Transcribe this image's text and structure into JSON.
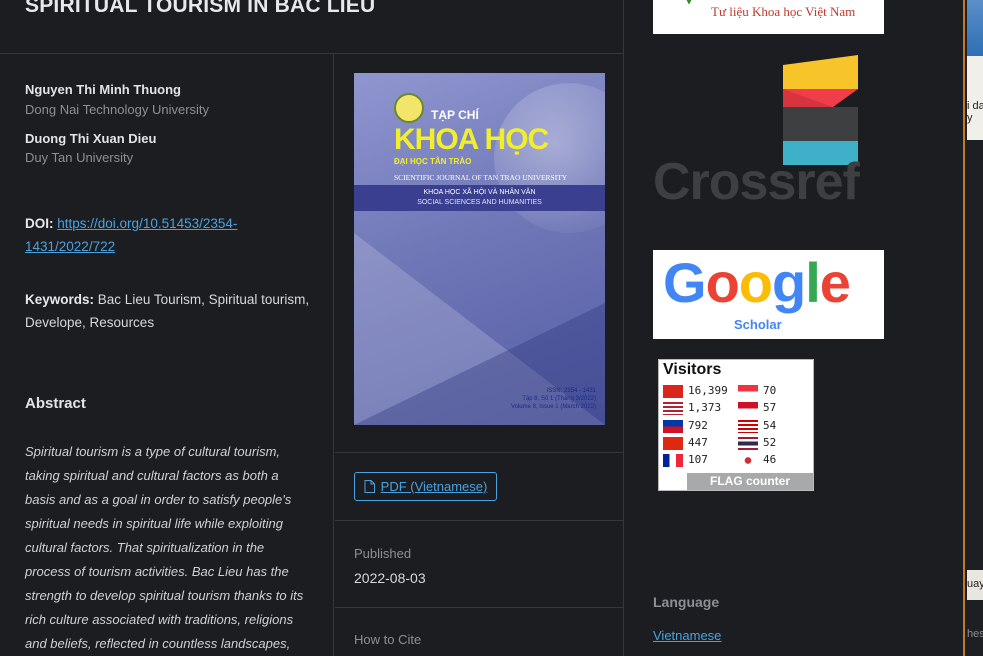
{
  "article": {
    "title": "SPIRITUAL TOURISM IN BAC LIEU",
    "authors": [
      {
        "name": "Nguyen Thi Minh Thuong",
        "affiliation": "Dong Nai Technology University"
      },
      {
        "name": "Duong Thi Xuan Dieu",
        "affiliation": "Duy Tan University"
      }
    ],
    "doi_label": "DOI:",
    "doi_url": "https://doi.org/10.51453/2354-1431/2022/722",
    "keywords_label": "Keywords:",
    "keywords": "Bac Lieu Tourism, Spiritual tourism, Develope, Resources",
    "abstract_heading": "Abstract",
    "abstract": "Spiritual tourism is a type of cultural tourism, taking spiritual and cultural factors as both a basis and as a goal in order to satisfy people's spiritual needs in spiritual life while exploiting cultural factors. That spiritualization in the process of tourism activities. Bac Lieu has the strength to develop spiritual tourism thanks to its rich culture associated with traditions, religions and beliefs, reflected in countless landscapes, monuments and"
  },
  "cover": {
    "line1": "TẠP CHÍ",
    "line2": "KHOA HỌC",
    "line3": "ĐẠI HỌC TÂN TRÀO",
    "line4": "SCIENTIFIC JOURNAL OF TAN TRAO UNIVERSITY",
    "line5": "KHOA HỌC XÃ HỘI VÀ NHÂN VĂN",
    "line6": "SOCIAL SCIENCES AND HUMANITIES",
    "issn": "ISSN: 2354 - 1431",
    "vol_vi": "Tập 8, Số 1 (Tháng 3/2022)",
    "vol_en": "Volume 8, Issue 1 (March 2022)"
  },
  "galley": {
    "pdf_label": "PDF (Vietnamese)"
  },
  "published": {
    "label": "Published",
    "date": "2022-08-03"
  },
  "cite": {
    "label": "How to Cite"
  },
  "sidebar": {
    "citation_text": "Tư liệu Khoa học Việt Nam",
    "crossref_text": "Crossref",
    "scholar_text": "Google",
    "scholar_sub": "Scholar",
    "visitors_title": "Visitors",
    "visitors_left": [
      {
        "flag": "vietnam-flag-icon",
        "count": "16,399"
      },
      {
        "flag": "usa-flag-icon",
        "count": "1,373"
      },
      {
        "flag": "philippines-flag-icon",
        "count": "792"
      },
      {
        "flag": "china-flag-icon",
        "count": "447"
      },
      {
        "flag": "france-flag-icon",
        "count": "107"
      }
    ],
    "visitors_right": [
      {
        "flag": "singapore-flag-icon",
        "count": "70"
      },
      {
        "flag": "indonesia-flag-icon",
        "count": "57"
      },
      {
        "flag": "malaysia-flag-icon",
        "count": "54"
      },
      {
        "flag": "thailand-flag-icon",
        "count": "52"
      },
      {
        "flag": "south-korea-flag-icon",
        "count": "46"
      }
    ],
    "flag_counter_text": "FLAG counter",
    "language_heading": "Language",
    "language_value": "Vietnamese"
  },
  "edge": {
    "t1": "i da",
    "t2": "y",
    "t3": "uay",
    "t4": "hes"
  }
}
